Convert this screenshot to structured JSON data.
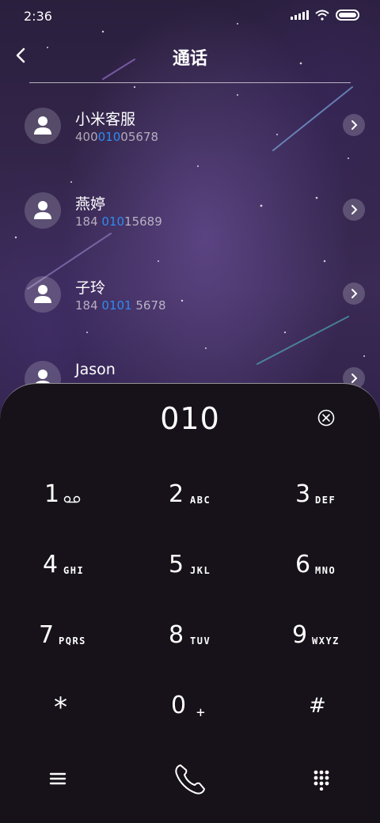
{
  "status_bar": {
    "time": "2:36"
  },
  "header": {
    "title": "通话"
  },
  "contacts": [
    {
      "name": "小米客服",
      "number_pre": "400",
      "number_hl": "010",
      "number_post": "05678"
    },
    {
      "name": "燕婷",
      "number_pre": "184 ",
      "number_hl": "010",
      "number_post": "15689"
    },
    {
      "name": "子玲",
      "number_pre": "184 ",
      "number_hl": "0101",
      "number_post": " 5678"
    },
    {
      "name": "Jason",
      "number_pre": "",
      "number_hl": "",
      "number_post": ""
    }
  ],
  "dialer": {
    "display": "010",
    "keys": [
      {
        "digit": "1",
        "letters": ""
      },
      {
        "digit": "2",
        "letters": "ABC"
      },
      {
        "digit": "3",
        "letters": "DEF"
      },
      {
        "digit": "4",
        "letters": "GHI"
      },
      {
        "digit": "5",
        "letters": "JKL"
      },
      {
        "digit": "6",
        "letters": "MNO"
      },
      {
        "digit": "7",
        "letters": "PQRS"
      },
      {
        "digit": "8",
        "letters": "TUV"
      },
      {
        "digit": "9",
        "letters": "WXYZ"
      },
      {
        "digit": "*",
        "letters": ""
      },
      {
        "digit": "0",
        "letters": "+"
      },
      {
        "digit": "#",
        "letters": ""
      }
    ]
  },
  "colors": {
    "highlight": "#2e8bf0",
    "panel": "#171219"
  },
  "icons": [
    "back-arrow-icon",
    "signal-icon",
    "wifi-icon",
    "battery-icon",
    "person-icon",
    "chevron-right-icon",
    "clear-input-icon",
    "voicemail-icon",
    "menu-icon",
    "phone-call-icon",
    "dialpad-icon"
  ]
}
